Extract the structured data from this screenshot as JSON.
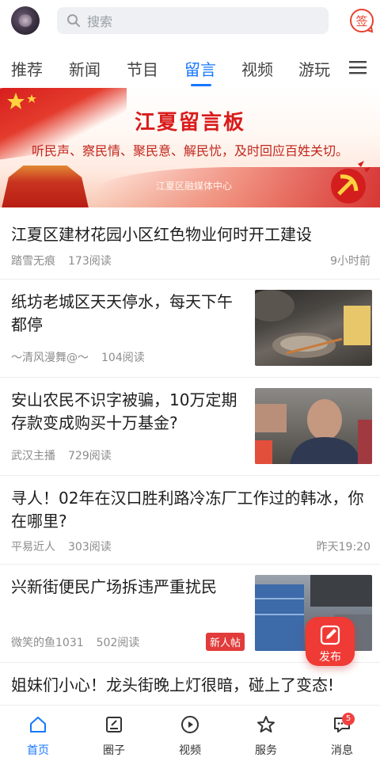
{
  "search": {
    "placeholder": "搜索"
  },
  "checkin": {
    "label": "签"
  },
  "tabs": [
    {
      "label": "推荐",
      "active": false
    },
    {
      "label": "新闻",
      "active": false
    },
    {
      "label": "节目",
      "active": false
    },
    {
      "label": "留言",
      "active": true
    },
    {
      "label": "视频",
      "active": false
    },
    {
      "label": "游玩",
      "active": false
    }
  ],
  "banner": {
    "title": "江夏留言板",
    "slogan": "听民声、察民情、聚民意、解民忧，及时回应百姓关切。",
    "org": "江夏区融媒体中心"
  },
  "feed": [
    {
      "title": "江夏区建材花园小区红色物业何时开工建设",
      "author": "踏雪无痕",
      "reads": "173阅读",
      "time": "9小时前",
      "thumb": ""
    },
    {
      "title": "纸坊老城区天天停水，每天下午都停",
      "author": "～清风漫舞@～",
      "reads": "104阅读",
      "time": "",
      "thumb": "pot-photo"
    },
    {
      "title": "安山农民不识字被骗，10万定期存款变成购买十万基金?",
      "author": "武汉主播",
      "reads": "729阅读",
      "time": "",
      "thumb": "man-photo"
    },
    {
      "title": "寻人！02年在汉口胜利路冷冻厂工作过的韩冰，你在哪里?",
      "author": "平易近人",
      "reads": "303阅读",
      "time": "昨天19:20",
      "thumb": ""
    },
    {
      "title": "兴新街便民广场拆违严重扰民",
      "author": "微笑的鱼1031",
      "reads": "502阅读",
      "time": "",
      "badge": "新人帖",
      "thumb": "building-photo"
    },
    {
      "title": "姐妹们小心！龙头街晚上灯很暗，碰上了变态!",
      "author": "",
      "reads": "",
      "time": "",
      "thumb": ""
    }
  ],
  "fab": {
    "label": "发布"
  },
  "bottom_nav": [
    {
      "label": "首页",
      "icon": "home-icon",
      "active": true
    },
    {
      "label": "圈子",
      "icon": "circle-icon",
      "active": false
    },
    {
      "label": "视频",
      "icon": "play-icon",
      "active": false
    },
    {
      "label": "服务",
      "icon": "star-icon",
      "active": false
    },
    {
      "label": "消息",
      "icon": "message-icon",
      "active": false,
      "badge": "5"
    }
  ],
  "colors": {
    "accent": "#1677ff",
    "red": "#e23b3b"
  }
}
